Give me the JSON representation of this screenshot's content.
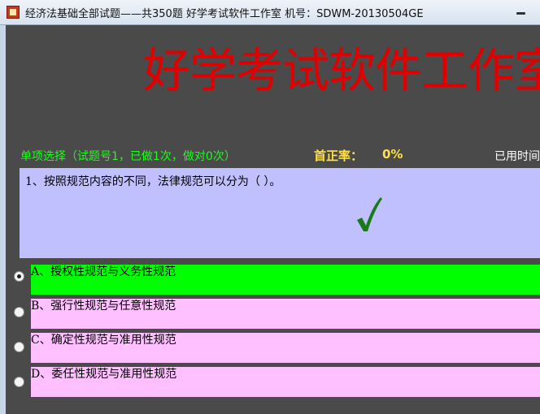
{
  "window": {
    "title": "经济法基础全部试题——共350题 好学考试软件工作室 机号：SDWM-20130504GE"
  },
  "banner": {
    "text": "好学考试软件工作室"
  },
  "status": {
    "question_type": "单项选择（试题号1，已做1次，做对0次）",
    "accuracy_label": "首正率：",
    "accuracy_value": "0%",
    "timer_label": "已用时间"
  },
  "question": {
    "text": "1、按照规范内容的不同，法律规范可以分为（ ）。",
    "result_icon": "checkmark-icon"
  },
  "options": [
    {
      "label": "A、授权性规范与义务性规范",
      "selected": true,
      "color": "#00ff00"
    },
    {
      "label": "B、强行性规范与任意性规范",
      "selected": false,
      "color": "#ffc0ff"
    },
    {
      "label": "C、确定性规范与准用性规范",
      "selected": false,
      "color": "#ffc0ff"
    },
    {
      "label": "D、委任性规范与准用性规范",
      "selected": false,
      "color": "#ffc0ff"
    }
  ],
  "colors": {
    "background": "#4a4a4a",
    "banner": "#e00000",
    "question_bg": "#c0c0ff",
    "correct_option": "#00ff00",
    "option_bg": "#ffc0ff",
    "check": "#1a7a1a"
  }
}
